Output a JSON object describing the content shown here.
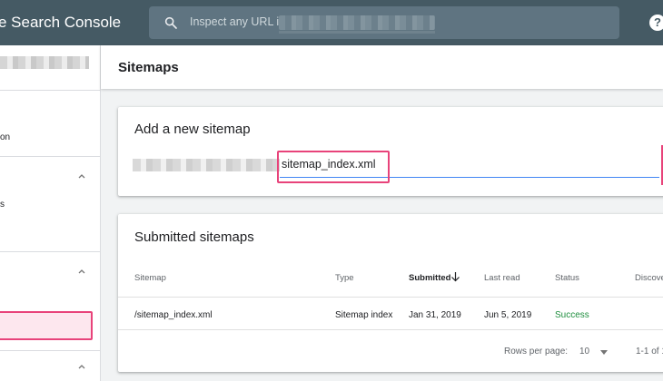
{
  "app": {
    "brand": "e Search Console"
  },
  "search": {
    "placeholder": "Inspect any URL in"
  },
  "sidebar": {
    "items": [
      {
        "label": "on"
      },
      {
        "label": "s"
      }
    ]
  },
  "page": {
    "title": "Sitemaps"
  },
  "add_card": {
    "title": "Add a new sitemap",
    "input_value": "sitemap_index.xml"
  },
  "submitted_card": {
    "title": "Submitted sitemaps",
    "columns": [
      "Sitemap",
      "Type",
      "Submitted",
      "Last read",
      "Status",
      "Discove"
    ],
    "rows": [
      {
        "sitemap": "/sitemap_index.xml",
        "type": "Sitemap index",
        "submitted": "Jan 31, 2019",
        "last_read": "Jun 5, 2019",
        "status": "Success"
      }
    ],
    "pagination": {
      "rows_per_page_label": "Rows per page:",
      "rows_per_page": "10",
      "range": "1-1 of 1"
    }
  },
  "colors": {
    "topbar": "#455a64",
    "accent": "#4285f4",
    "success": "#1e8e3e",
    "highlight": "#e8437a"
  },
  "icons": {
    "search": "search-icon",
    "help": "help-icon",
    "chevron": "chevron-up-icon",
    "sort": "arrow-down-icon"
  }
}
